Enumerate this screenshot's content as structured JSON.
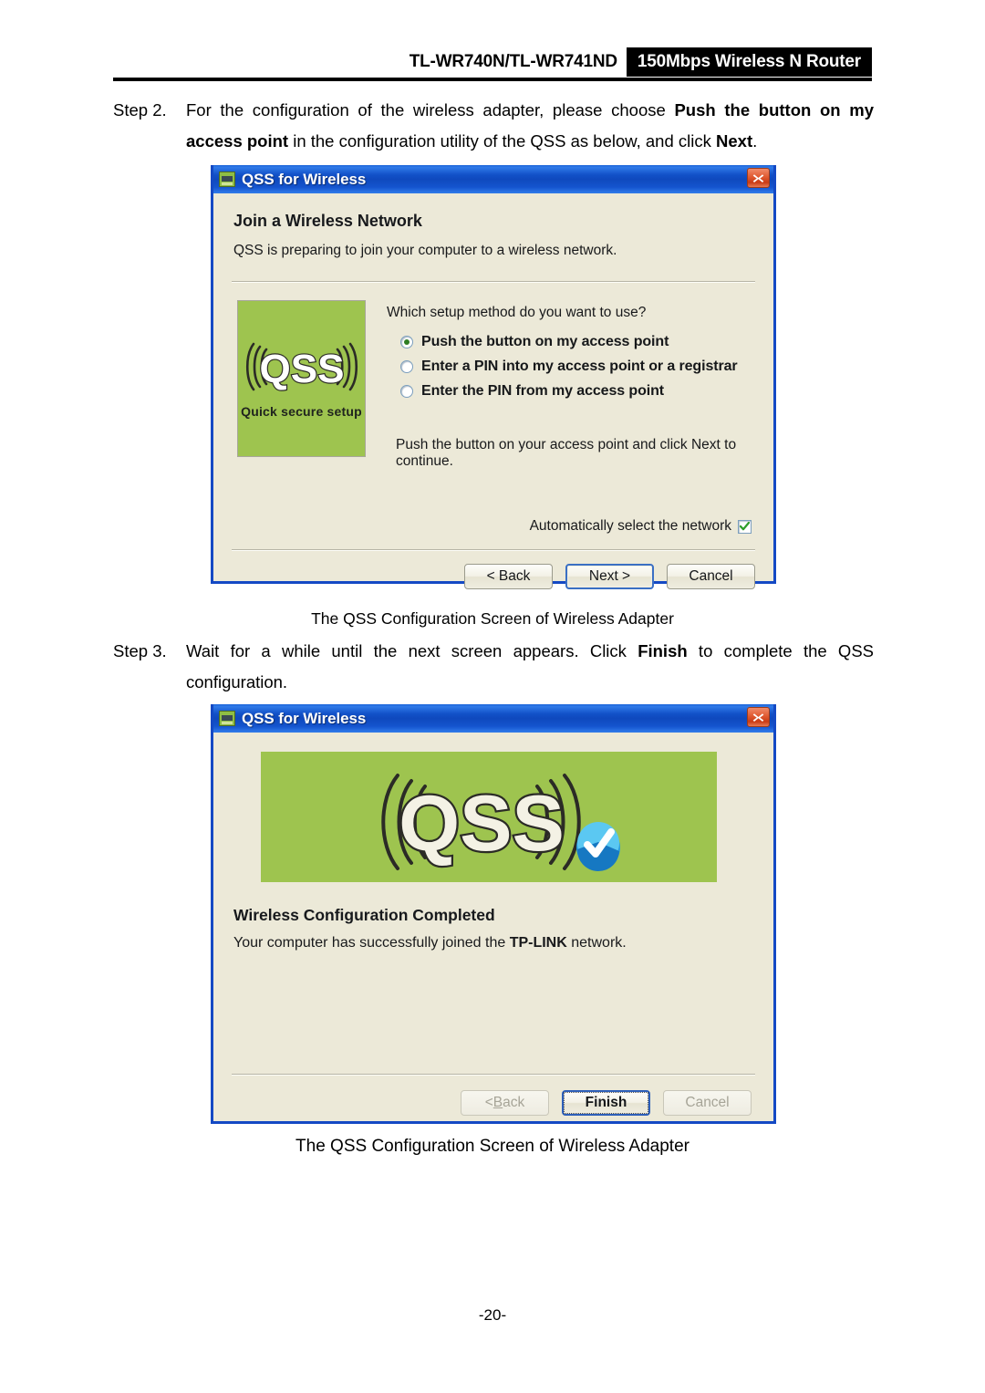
{
  "header": {
    "model": "TL-WR740N/TL-WR741ND",
    "badge": "150Mbps Wireless N Router"
  },
  "step2": {
    "label": "Step 2.",
    "text_a": "For the configuration of the wireless adapter, please choose ",
    "bold_a": "Push the button on my access point",
    "text_b": " in the configuration utility of the QSS as below, and click ",
    "bold_b": "Next",
    "text_c": "."
  },
  "step3": {
    "label": "Step 3.",
    "text_a": "Wait for a while until the next screen appears. Click ",
    "bold_a": "Finish",
    "text_b": " to complete the QSS configuration."
  },
  "caption1": "The QSS Configuration Screen of Wireless Adapter",
  "caption2": "The QSS Configuration Screen of Wireless Adapter",
  "page_number": "-20-",
  "dialog1": {
    "title": "QSS for Wireless",
    "close_icon": "close-icon",
    "heading": "Join a Wireless Network",
    "subtitle": "QSS is preparing to join your computer to a wireless network.",
    "logo_text": "QSS",
    "logo_caption": "Quick secure setup",
    "question": "Which setup method do you want to use?",
    "options": [
      {
        "label": "Push the button on my access point",
        "selected": true
      },
      {
        "label": "Enter a PIN into my access point or a registrar",
        "selected": false
      },
      {
        "label": "Enter the PIN from my access point",
        "selected": false
      }
    ],
    "hint": "Push the button on your access point and click Next to continue.",
    "checkbox_label": "Automatically select the network",
    "checkbox_checked": true,
    "buttons": [
      {
        "label": "< Back",
        "state": "normal"
      },
      {
        "label": "Next >",
        "state": "default"
      },
      {
        "label": "Cancel",
        "state": "normal"
      }
    ]
  },
  "dialog2": {
    "title": "QSS for Wireless",
    "close_icon": "close-icon",
    "logo_text": "QSS",
    "status_icon": "blue-check-badge-icon",
    "heading": "Wireless Configuration Completed",
    "text_a": "Your computer has successfully joined the ",
    "bold_a": "TP-LINK",
    "text_b": " network.",
    "buttons": [
      {
        "label": "< Back",
        "state": "disabled",
        "accel": "B"
      },
      {
        "label": "Finish",
        "state": "focused"
      },
      {
        "label": "Cancel",
        "state": "disabled"
      }
    ]
  },
  "colors": {
    "titlebar_blue": "#1251c8",
    "dialog_border": "#1449c4",
    "dialog_body": "#ece9d8",
    "qss_green": "#9ec44f",
    "close_red": "#d8491f",
    "badge_black": "#000000",
    "check_green": "#2f7d23",
    "status_blue": "#2a9ee0"
  }
}
